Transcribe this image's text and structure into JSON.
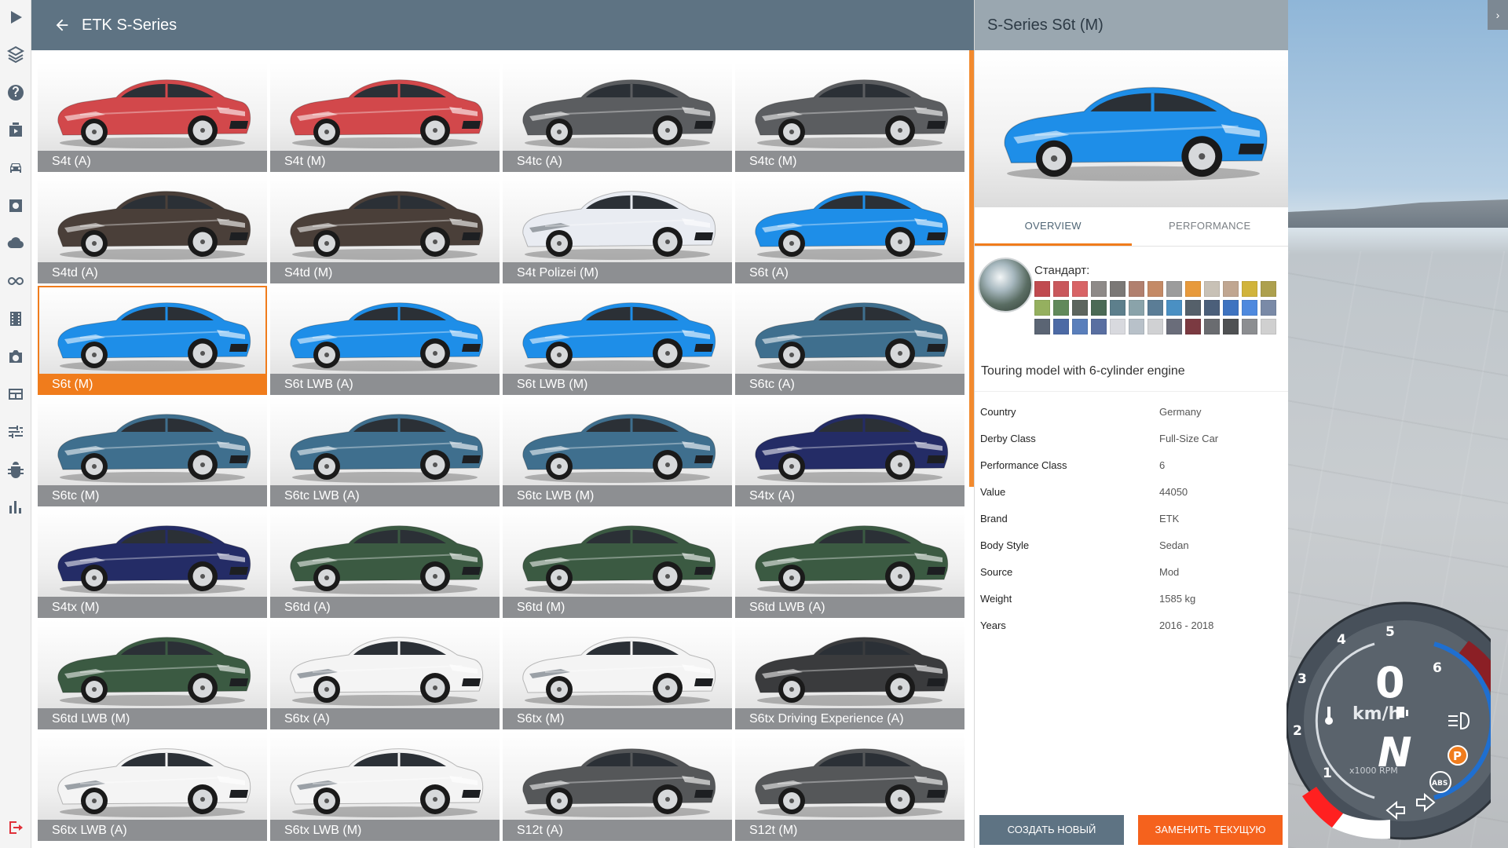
{
  "header": {
    "back_icon": "arrow-left-icon",
    "title": "ETK S-Series"
  },
  "grid": {
    "tiles": [
      {
        "label": "S4t (A)",
        "color": "#d2484b"
      },
      {
        "label": "S4t (M)",
        "color": "#d2484b"
      },
      {
        "label": "S4tc (A)",
        "color": "#5b5d60"
      },
      {
        "label": "S4tc (M)",
        "color": "#5b5d60"
      },
      {
        "label": "S4td (A)",
        "color": "#4a3f39"
      },
      {
        "label": "S4td (M)",
        "color": "#4a3f39"
      },
      {
        "label": "S4t Polizei (M)",
        "color": "#e9ecf2"
      },
      {
        "label": "S6t (A)",
        "color": "#1e8ee8"
      },
      {
        "label": "S6t (M)",
        "color": "#1e8ee8"
      },
      {
        "label": "S6t LWB (A)",
        "color": "#1e8ee8"
      },
      {
        "label": "S6t LWB (M)",
        "color": "#1e8ee8"
      },
      {
        "label": "S6tc (A)",
        "color": "#3f6f8e"
      },
      {
        "label": "S6tc (M)",
        "color": "#3f6f8e"
      },
      {
        "label": "S6tc LWB (A)",
        "color": "#3f6f8e"
      },
      {
        "label": "S6tc LWB (M)",
        "color": "#3f6f8e"
      },
      {
        "label": "S4tx (A)",
        "color": "#242c66"
      },
      {
        "label": "S4tx (M)",
        "color": "#242c66"
      },
      {
        "label": "S6td (A)",
        "color": "#3b5a42"
      },
      {
        "label": "S6td (M)",
        "color": "#3b5a42"
      },
      {
        "label": "S6td LWB (A)",
        "color": "#3b5a42"
      },
      {
        "label": "S6td LWB (M)",
        "color": "#3b5a42"
      },
      {
        "label": "S6tx (A)",
        "color": "#f4f4f4"
      },
      {
        "label": "S6tx (M)",
        "color": "#f4f4f4"
      },
      {
        "label": "S6tx Driving Experience (A)",
        "color": "#3a3b3d"
      },
      {
        "label": "S6tx LWB (A)",
        "color": "#f4f4f4"
      },
      {
        "label": "S6tx LWB (M)",
        "color": "#f4f4f4"
      },
      {
        "label": "S12t (A)",
        "color": "#555759"
      },
      {
        "label": "S12t (M)",
        "color": "#555759"
      }
    ],
    "selected": "S6t (M)"
  },
  "detail": {
    "title": "S-Series S6t (M)",
    "preview_color": "#1e8ee8",
    "tabs": [
      "OVERVIEW",
      "PERFORMANCE"
    ],
    "active_tab": "OVERVIEW",
    "paint_label": "Стандарт:",
    "swatches": [
      "#c04a4f",
      "#c9585c",
      "#d86466",
      "#8e8a88",
      "#7b7876",
      "#b1806f",
      "#c48a66",
      "#9c9c9c",
      "#e79a3c",
      "#c8c1b6",
      "#c0a691",
      "#d1b43c",
      "#ada04e",
      "#95b05f",
      "#61895a",
      "#5d655e",
      "#4b6a55",
      "#5d7f8c",
      "#8aa3aa",
      "#5b7d96",
      "#4a90c3",
      "#55606a",
      "#4b5f7a",
      "#3e73c0",
      "#4e89de",
      "#7a8aa7",
      "#5b6574",
      "#4c6aa5",
      "#5a7fbb",
      "#596fa1",
      "#d8d9de",
      "#b8c1c9",
      "#d0d1d3",
      "#6a6d7a",
      "#7b3a41",
      "#6a6c70",
      "#4f5153",
      "#8c8e91",
      "#d0d0d0"
    ],
    "description": "Touring model with 6-cylinder engine",
    "specs": [
      {
        "key": "Country",
        "value": "Germany"
      },
      {
        "key": "Derby Class",
        "value": "Full-Size Car"
      },
      {
        "key": "Performance Class",
        "value": "6"
      },
      {
        "key": "Value",
        "value": "44050"
      },
      {
        "key": "Brand",
        "value": "ETK"
      },
      {
        "key": "Body Style",
        "value": "Sedan"
      },
      {
        "key": "Source",
        "value": "Mod"
      },
      {
        "key": "Weight",
        "value": "1585 kg"
      },
      {
        "key": "Years",
        "value": "2016 - 2018"
      }
    ],
    "buttons": {
      "create": "СОЗДАТЬ НОВЫЙ",
      "replace": "ЗАМЕНИТЬ ТЕКУЩУЮ"
    }
  },
  "rail_icons": [
    "play-icon",
    "layers-icon",
    "help-icon",
    "media-icon",
    "car-icon",
    "settings-icon",
    "cloud-icon",
    "infinity-icon",
    "film-icon",
    "camera-icon",
    "layout-icon",
    "sliders-icon",
    "bug-icon",
    "chart-icon",
    "exit-icon"
  ],
  "gauge": {
    "speed": "0",
    "speed_unit": "km/h",
    "gear": "N",
    "rpm_label": "x1000 RPM",
    "rpm_ticks": [
      "1",
      "2",
      "3",
      "4",
      "5",
      "6"
    ],
    "indicators": [
      "P",
      "ABS"
    ]
  },
  "scene": {
    "minimize_icon": "chevron-right-icon"
  }
}
